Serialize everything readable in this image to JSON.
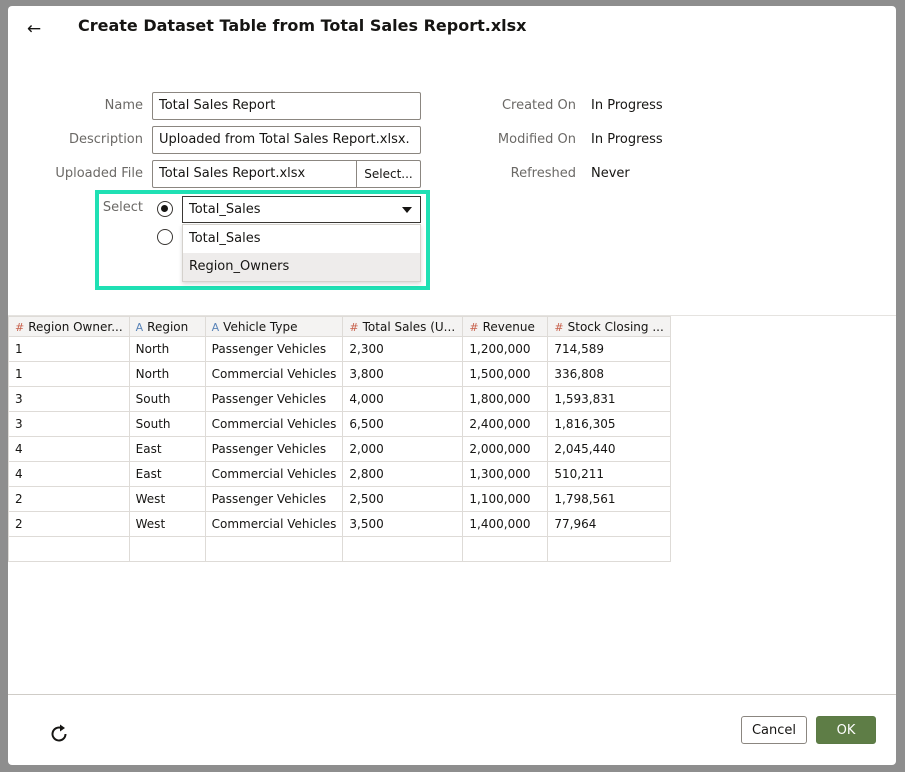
{
  "dialog": {
    "title": "Create Dataset Table from Total Sales Report.xlsx",
    "back_icon": "arrow-left-icon"
  },
  "form": {
    "name_label": "Name",
    "name_value": "Total Sales Report",
    "description_label": "Description",
    "description_value": "Uploaded from Total Sales Report.xlsx.",
    "file_label": "Uploaded File",
    "file_value": "Total Sales Report.xlsx",
    "select_button": "Select...",
    "select_label": "Select",
    "sheet_selected": "Total_Sales",
    "sheet_options": [
      "Total_Sales",
      "Region_Owners"
    ]
  },
  "meta": {
    "created_label": "Created On",
    "created_value": "In Progress",
    "modified_label": "Modified On",
    "modified_value": "In Progress",
    "refreshed_label": "Refreshed",
    "refreshed_value": "Never"
  },
  "table": {
    "columns": [
      {
        "type": "#",
        "label": "Region Owner..."
      },
      {
        "type": "A",
        "label": "Region"
      },
      {
        "type": "A",
        "label": "Vehicle Type"
      },
      {
        "type": "#",
        "label": "Total Sales (U..."
      },
      {
        "type": "#",
        "label": "Revenue"
      },
      {
        "type": "#",
        "label": "Stock Closing ..."
      }
    ],
    "rows": [
      [
        "1",
        "North",
        "Passenger Vehicles",
        "2,300",
        "1,200,000",
        "714,589"
      ],
      [
        "1",
        "North",
        "Commercial Vehicles",
        "3,800",
        "1,500,000",
        "336,808"
      ],
      [
        "3",
        "South",
        "Passenger Vehicles",
        "4,000",
        "1,800,000",
        "1,593,831"
      ],
      [
        "3",
        "South",
        "Commercial Vehicles",
        "6,500",
        "2,400,000",
        "1,816,305"
      ],
      [
        "4",
        "East",
        "Passenger Vehicles",
        "2,000",
        "2,000,000",
        "2,045,440"
      ],
      [
        "4",
        "East",
        "Commercial Vehicles",
        "2,800",
        "1,300,000",
        "510,211"
      ],
      [
        "2",
        "West",
        "Passenger Vehicles",
        "2,500",
        "1,100,000",
        "1,798,561"
      ],
      [
        "2",
        "West",
        "Commercial Vehicles",
        "3,500",
        "1,400,000",
        "77,964"
      ]
    ]
  },
  "footer": {
    "refresh_icon": "refresh-icon",
    "cancel_label": "Cancel",
    "ok_label": "OK"
  },
  "colors": {
    "highlight": "#1fe0b4",
    "ok_button": "#5e7d46",
    "numeric_icon": "#c7604b",
    "text_icon": "#5a84b8"
  }
}
